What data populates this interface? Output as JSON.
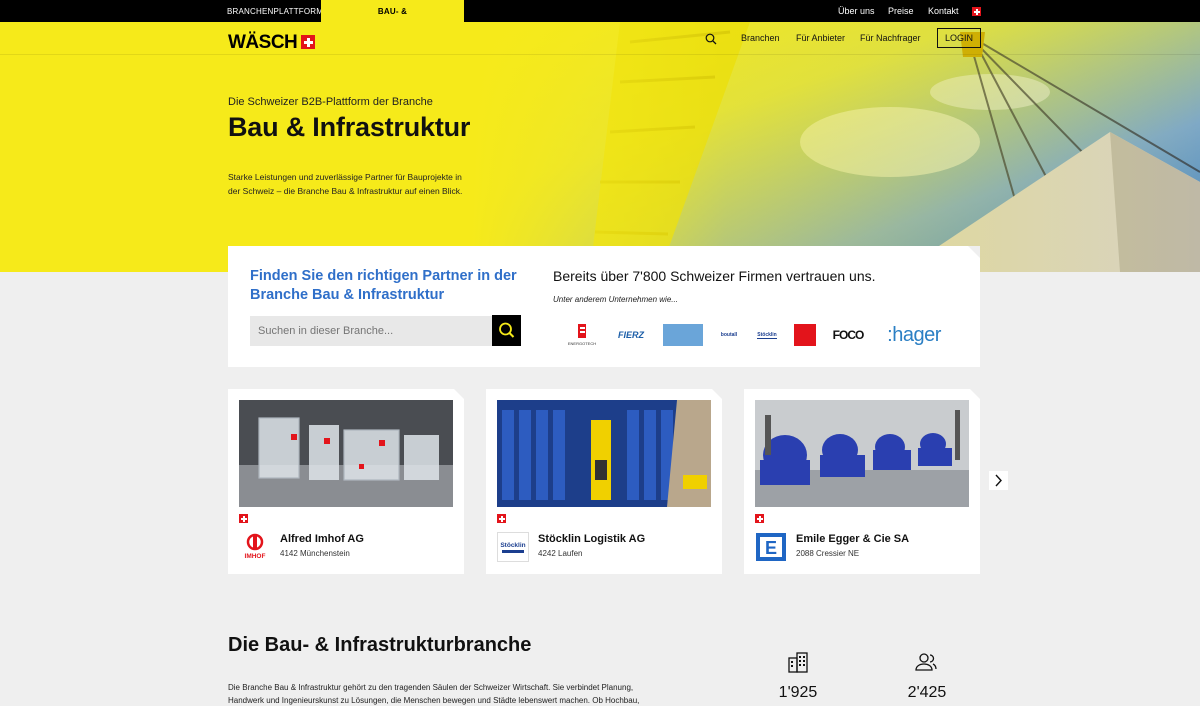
{
  "topbar": {
    "tab_platform": "BRANCHENPLATTFORM",
    "tab_branch": "BAU- & INFRASTRUKTURBRANCHE",
    "links": [
      "Über uns",
      "Preise",
      "Kontakt"
    ]
  },
  "nav": {
    "logo": "WÄSCH",
    "items": [
      "Branchen",
      "Für Anbieter",
      "Für Nachfrager"
    ],
    "login": "LOGIN"
  },
  "hero": {
    "kicker": "Die Schweizer B2B-Plattform der Branche",
    "title": "Bau & Infrastruktur",
    "text": "Starke Leistungen und zuverlässige Partner für Bauprojekte in der Schweiz – die Branche Bau & Infrastruktur auf einen Blick."
  },
  "search": {
    "title": "Finden Sie den richtigen Partner in der Branche Bau & Infrastruktur",
    "placeholder": "Suchen in dieser Branche...",
    "trust_headline": "Bereits über 7'800 Schweizer Firmen vertrauen uns.",
    "trust_sub": "Unter anderem Unternehmen wie...",
    "brands": [
      "ENERGOTECH",
      "FIERZ",
      "boutall",
      "Stöcklin",
      "FOCO",
      ":hager"
    ]
  },
  "companies": [
    {
      "name": "Alfred Imhof AG",
      "location": "4142 Münchenstein",
      "logo_text": "IMHOF"
    },
    {
      "name": "Stöcklin Logistik AG",
      "location": "4242 Laufen",
      "logo_text": "Stöcklin"
    },
    {
      "name": "Emile Egger & Cie SA",
      "location": "2088 Cressier NE",
      "logo_text": "E"
    }
  ],
  "section": {
    "title": "Die Bau- & Infrastrukturbranche",
    "text": "Die Branche Bau & Infrastruktur gehört zu den tragenden Säulen der Schweizer Wirtschaft. Sie verbindet Planung, Handwerk und Ingenieurskunst zu Lösungen, die Menschen bewegen und Städte lebenswert machen. Ob Hochbau,"
  },
  "stats": [
    {
      "icon": "buildings-icon",
      "value": "1'925"
    },
    {
      "icon": "users-icon",
      "value": "2'425"
    }
  ],
  "colors": {
    "brand_yellow": "#f6ea1a",
    "link_blue": "#2f6fc9",
    "swiss_red": "#e3141b"
  }
}
